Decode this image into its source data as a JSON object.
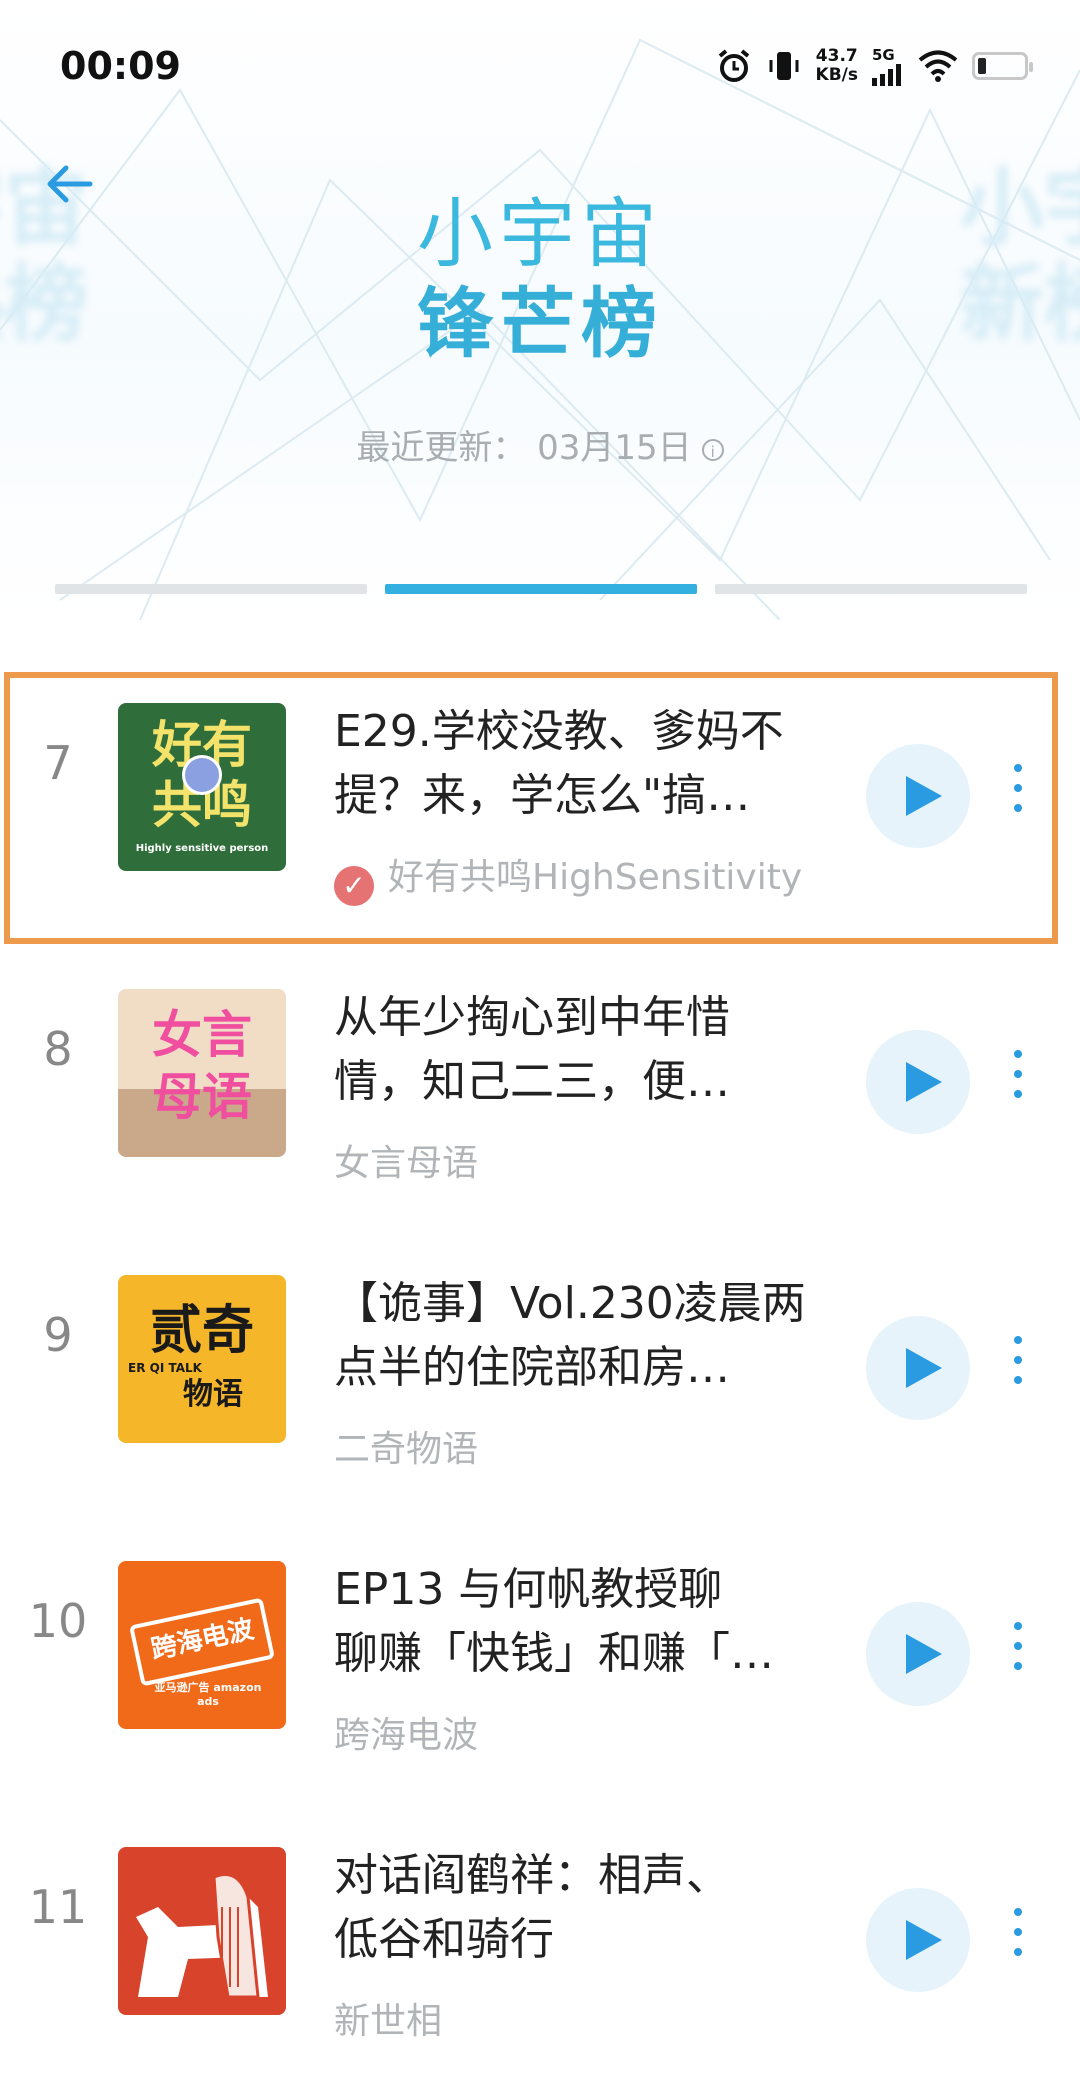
{
  "status_bar": {
    "time": "00:09",
    "net_speed_value": "43.7",
    "net_speed_unit": "KB/s",
    "network": "5G",
    "icons": [
      "alarm-icon",
      "vibrate-icon",
      "signal-icon",
      "wifi-icon",
      "battery-icon"
    ]
  },
  "header": {
    "back_icon": "arrow-left-icon",
    "title_line1": "小宇宙",
    "title_line2": "锋芒榜",
    "ghost_left": "宇宙\n热榜",
    "ghost_right": "小宇\n新榜",
    "update_text": "最近更新： 03月15日",
    "info_icon": "info-icon",
    "tabs": [
      {
        "active": false
      },
      {
        "active": true
      },
      {
        "active": false
      }
    ]
  },
  "colors": {
    "title": "#3bb8dd",
    "accent": "#2a9be0",
    "highlight": "#ee9a4d",
    "verified": "#e57373"
  },
  "episodes": [
    {
      "rank": "7",
      "title_line1": "E29.学校没教、爹妈不",
      "title_line2": "提？来，学怎么\"搞…",
      "author": "好有共鸣HighSensitivity",
      "verified": true,
      "cover": {
        "bg": "#2f6e3b",
        "text1": "好有",
        "text2": "共鸣",
        "sub": "Highly sensitive person"
      }
    },
    {
      "rank": "8",
      "title_line1": "从年少掏心到中年惜",
      "title_line2": "情，知己二三，便…",
      "author": "女言母语",
      "verified": false,
      "cover": {
        "bg": "#f1dcc6",
        "text1": "女言",
        "text2": "母语",
        "sub": ""
      }
    },
    {
      "rank": "9",
      "title_line1": "【诡事】Vol.230凌晨两",
      "title_line2": "点半的住院部和房…",
      "author": "二奇物语",
      "verified": false,
      "cover": {
        "bg": "#f5b629",
        "text1": "贰奇",
        "text2": "物语",
        "sub": "ER QI TALK"
      }
    },
    {
      "rank": "10",
      "title_line1": "EP13 与何帆教授聊",
      "title_line2": "聊赚「快钱」和赚「…",
      "author": "跨海电波",
      "verified": false,
      "cover": {
        "bg": "#f06a1a",
        "text1": "跨海电波",
        "text2": "",
        "sub": "亚马逊广告 amazon ads"
      }
    },
    {
      "rank": "11",
      "title_line1": "对话阎鹤祥：相声、",
      "title_line2": "低谷和骑行",
      "author": "新世相",
      "verified": false,
      "cover": {
        "bg": "#d8432c",
        "text1": "",
        "text2": "",
        "sub": ""
      }
    }
  ]
}
